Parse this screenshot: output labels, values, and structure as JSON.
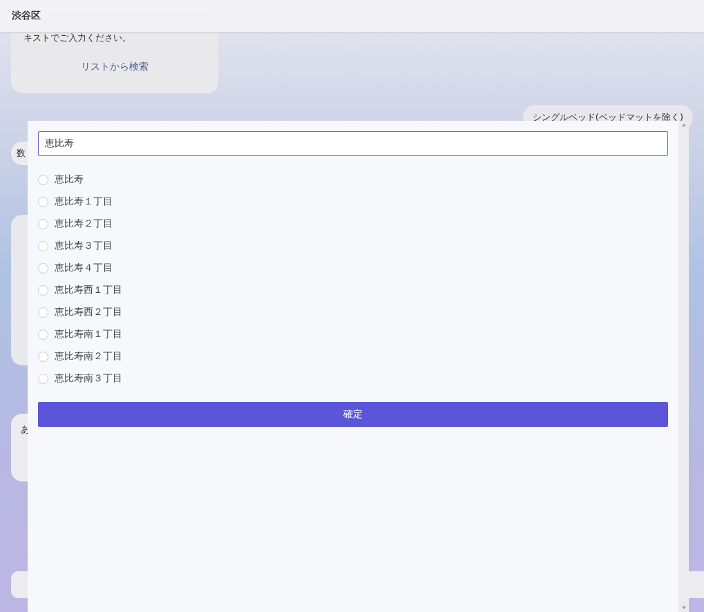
{
  "header": {
    "title": "渋谷区"
  },
  "chat": {
    "card": {
      "text": "キストでご入力ください。",
      "link": "リストから検索"
    },
    "user_reply": "シングルベッド(ベッドマットを除く)",
    "partial_bubbles": [
      "数",
      "あ"
    ]
  },
  "dialog": {
    "search": {
      "value": "恵比寿"
    },
    "options": [
      {
        "label": "恵比寿",
        "selected": false
      },
      {
        "label": "恵比寿１丁目",
        "selected": false
      },
      {
        "label": "恵比寿２丁目",
        "selected": false
      },
      {
        "label": "恵比寿３丁目",
        "selected": false
      },
      {
        "label": "恵比寿４丁目",
        "selected": false
      },
      {
        "label": "恵比寿西１丁目",
        "selected": false
      },
      {
        "label": "恵比寿西２丁目",
        "selected": false
      },
      {
        "label": "恵比寿南１丁目",
        "selected": false
      },
      {
        "label": "恵比寿南２丁目",
        "selected": false
      },
      {
        "label": "恵比寿南３丁目",
        "selected": false
      }
    ],
    "confirm": "確定"
  }
}
